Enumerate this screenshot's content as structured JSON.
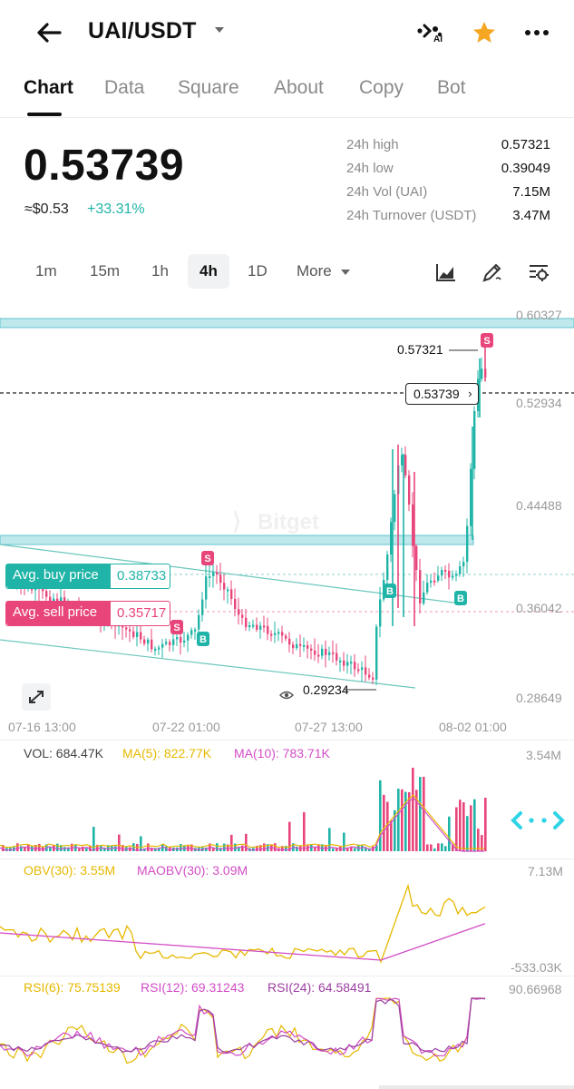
{
  "header": {
    "pair": "UAI/USDT",
    "ai_badge": "AI"
  },
  "tabs": [
    "Chart",
    "Data",
    "Square",
    "About",
    "Copy",
    "Bot"
  ],
  "price": {
    "last": "0.53739",
    "usd": "≈$0.53",
    "change": "+33.31%"
  },
  "stats": [
    {
      "label": "24h high",
      "value": "0.57321"
    },
    {
      "label": "24h low",
      "value": "0.39049"
    },
    {
      "label": "24h Vol (UAI)",
      "value": "7.15M"
    },
    {
      "label": "24h Turnover (USDT)",
      "value": "3.47M"
    }
  ],
  "intervals": [
    "1m",
    "15m",
    "1h",
    "4h",
    "1D",
    "More"
  ],
  "active_interval": "4h",
  "main_chart": {
    "y_ticks": [
      "0.60327",
      "0.52934",
      "0.44488",
      "0.36042",
      "0.28649"
    ],
    "x_ticks": [
      "07-16 13:00",
      "07-22 01:00",
      "07-27 13:00",
      "08-02 01:00"
    ],
    "current_price_tag": "0.53739",
    "high_marker": "0.57321",
    "low_marker": "0.29234",
    "avg_buy_label": "Avg. buy price",
    "avg_buy_value": "0.38733",
    "avg_sell_label": "Avg. sell price",
    "avg_sell_value": "0.35717",
    "watermark": "Bitget",
    "marker_b": "B",
    "marker_s": "S"
  },
  "volume_panel": {
    "vol": "VOL: 684.47K",
    "ma5": "MA(5): 822.77K",
    "ma10": "MA(10): 783.71K",
    "max": "3.54M"
  },
  "obv_panel": {
    "obv": "OBV(30): 3.55M",
    "maobv": "MAOBV(30): 3.09M",
    "max": "7.13M",
    "min": "-533.03K"
  },
  "rsi_panel": {
    "rsi6": "RSI(6): 75.75139",
    "rsi12": "RSI(12): 69.31243",
    "rsi24": "RSI(24): 64.58491",
    "max": "90.66968"
  },
  "colors": {
    "up": "#1fb4a7",
    "down": "#e8457a",
    "ma5": "#e6b800",
    "ma10": "#d24dc6",
    "accent_orange": "#f5a623"
  }
}
